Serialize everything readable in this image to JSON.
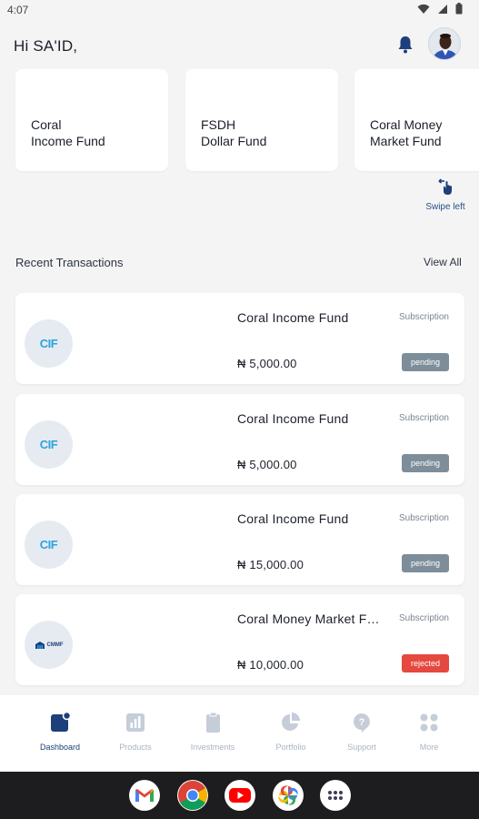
{
  "status_bar": {
    "time": "4:07"
  },
  "header": {
    "greeting": "Hi SA'ID,"
  },
  "funds": [
    {
      "name": "Coral\nIncome Fund"
    },
    {
      "name": "FSDH\nDollar Fund"
    },
    {
      "name": "Coral Money\nMarket  Fund"
    }
  ],
  "swipe_hint": "Swipe left",
  "transactions_section": {
    "title": "Recent Transactions",
    "view_all": "View All"
  },
  "transactions": [
    {
      "logo": "CIF",
      "fund": "Coral Income Fund",
      "type": "Subscription",
      "amount": "₦  5,000.00",
      "status": "pending"
    },
    {
      "logo": "CIF",
      "fund": "Coral Income Fund",
      "type": "Subscription",
      "amount": "₦  5,000.00",
      "status": "pending"
    },
    {
      "logo": "CIF",
      "fund": "Coral Income Fund",
      "type": "Subscription",
      "amount": "₦  15,000.00",
      "status": "pending"
    },
    {
      "logo": "CMMF",
      "fund": "Coral Money Market Fund",
      "type": "Subscription",
      "amount": "₦  10,000.00",
      "status": "rejected"
    }
  ],
  "nav": [
    {
      "label": "Dashboard",
      "icon": "dashboard-icon",
      "active": true
    },
    {
      "label": "Products",
      "icon": "products-icon",
      "active": false
    },
    {
      "label": "Investments",
      "icon": "investments-icon",
      "active": false
    },
    {
      "label": "Portfolio",
      "icon": "portfolio-icon",
      "active": false
    },
    {
      "label": "Support",
      "icon": "support-icon",
      "active": false
    },
    {
      "label": "More",
      "icon": "more-icon",
      "active": false
    }
  ],
  "dock_apps": [
    "gmail-icon",
    "chrome-icon",
    "youtube-icon",
    "photos-icon",
    "app-drawer-icon"
  ],
  "colors": {
    "brand": "#1d3f7a",
    "pending": "#7d8e9a",
    "rejected": "#e5483f",
    "nav_inactive": "#a9b3c2",
    "background": "#f4f4f5"
  }
}
